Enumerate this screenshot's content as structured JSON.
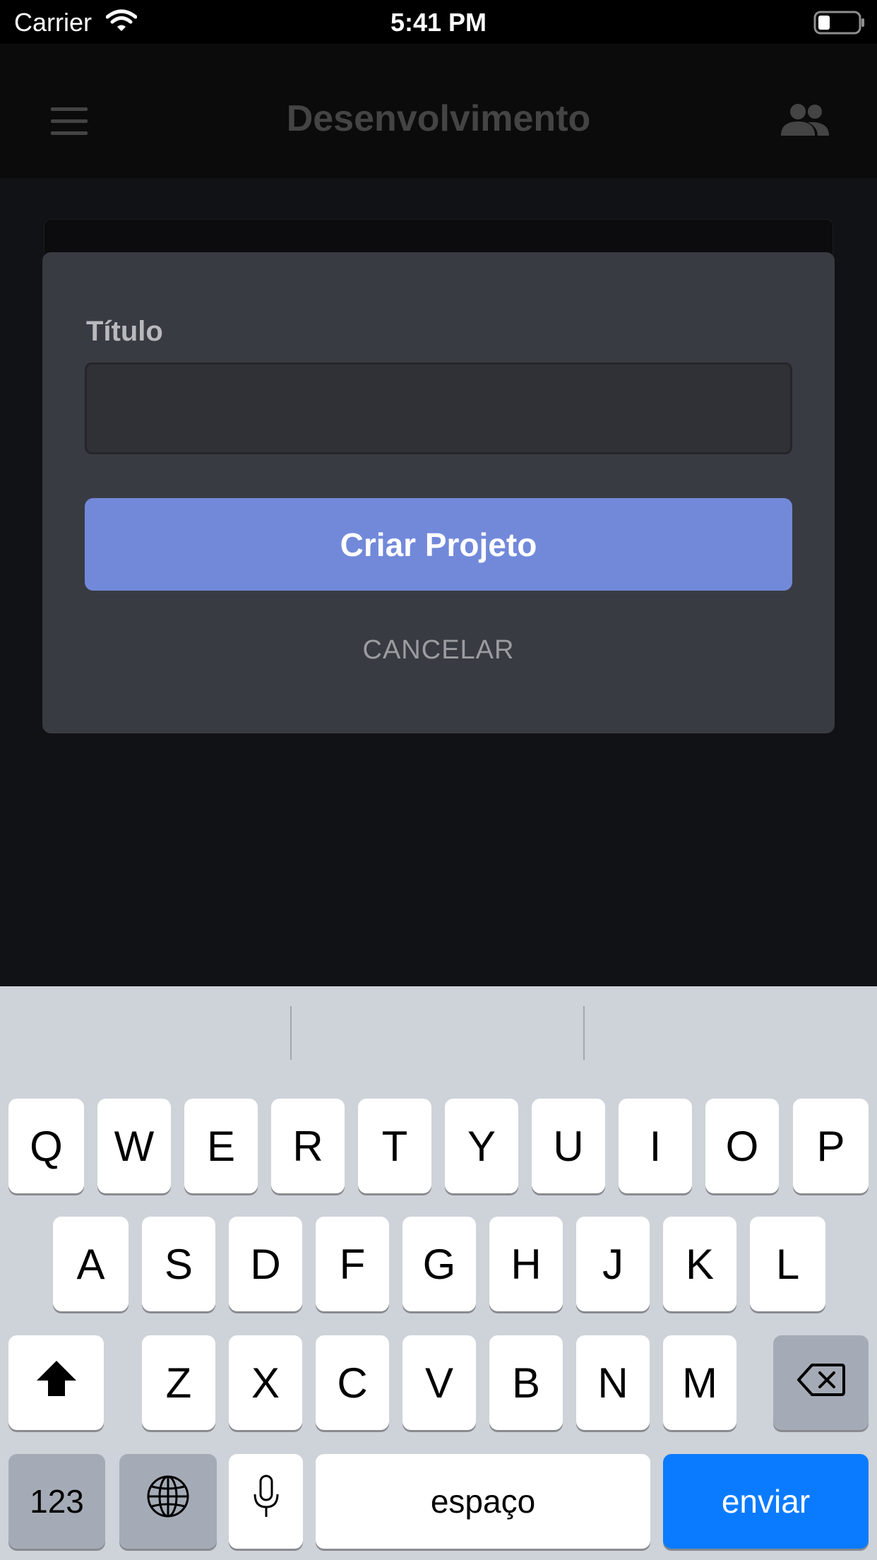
{
  "status_bar": {
    "carrier": "Carrier",
    "time": "5:41 PM"
  },
  "header": {
    "title": "Desenvolvimento",
    "menu_icon": "hamburger-menu-icon",
    "members_icon": "people-icon"
  },
  "modal": {
    "field_label": "Título",
    "title_value": "",
    "create_button": "Criar Projeto",
    "cancel_link": "CANCELAR",
    "accent_color": "#7289da"
  },
  "keyboard": {
    "row1": [
      "Q",
      "W",
      "E",
      "R",
      "T",
      "Y",
      "U",
      "I",
      "O",
      "P"
    ],
    "row2": [
      "A",
      "S",
      "D",
      "F",
      "G",
      "H",
      "J",
      "K",
      "L"
    ],
    "row3": [
      "Z",
      "X",
      "C",
      "V",
      "B",
      "N",
      "M"
    ],
    "numbers_key": "123",
    "space_key": "espaço",
    "return_key": "enviar",
    "return_color": "#0a7bff"
  }
}
